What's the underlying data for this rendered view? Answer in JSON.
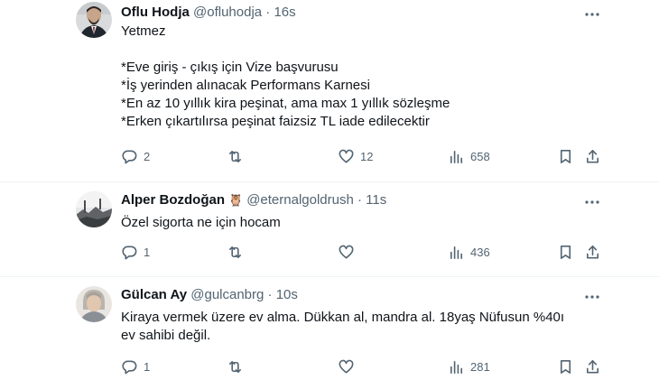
{
  "tweets": [
    {
      "name": "Oflu Hodja",
      "handle": "@ofluhodja",
      "time": "16s",
      "body": "Yetmez\n\n*Eve giriş - çıkış için Vize başvurusu\n*İş yerinden alınacak Performans Karnesi\n*En az 10 yıllık kira peşinat, ama max 1 yıllık sözleşme\n*Erken çıkartılırsa peşinat faizsiz TL iade edilecektir",
      "replies": "2",
      "retweets": "",
      "likes": "12",
      "views": "658"
    },
    {
      "name": "Alper Bozdoğan",
      "badge": "🦉",
      "handle": "@eternalgoldrush",
      "time": "11s",
      "body": "Özel sigorta ne için hocam",
      "replies": "1",
      "retweets": "",
      "likes": "",
      "views": "436"
    },
    {
      "name": "Gülcan Ay",
      "handle": "@gulcanbrg",
      "time": "10s",
      "body": "Kiraya vermek üzere ev alma. Dükkan al, mandra al. 18yaş Nüfusun %40ı ev sahibi değil.",
      "replies": "1",
      "retweets": "",
      "likes": "",
      "views": "281"
    }
  ],
  "icons": {
    "more": "more-horizontal-icon",
    "reply": "reply-icon",
    "retweet": "retweet-icon",
    "like": "heart-icon",
    "views": "views-icon",
    "bookmark": "bookmark-icon",
    "share": "share-icon"
  }
}
